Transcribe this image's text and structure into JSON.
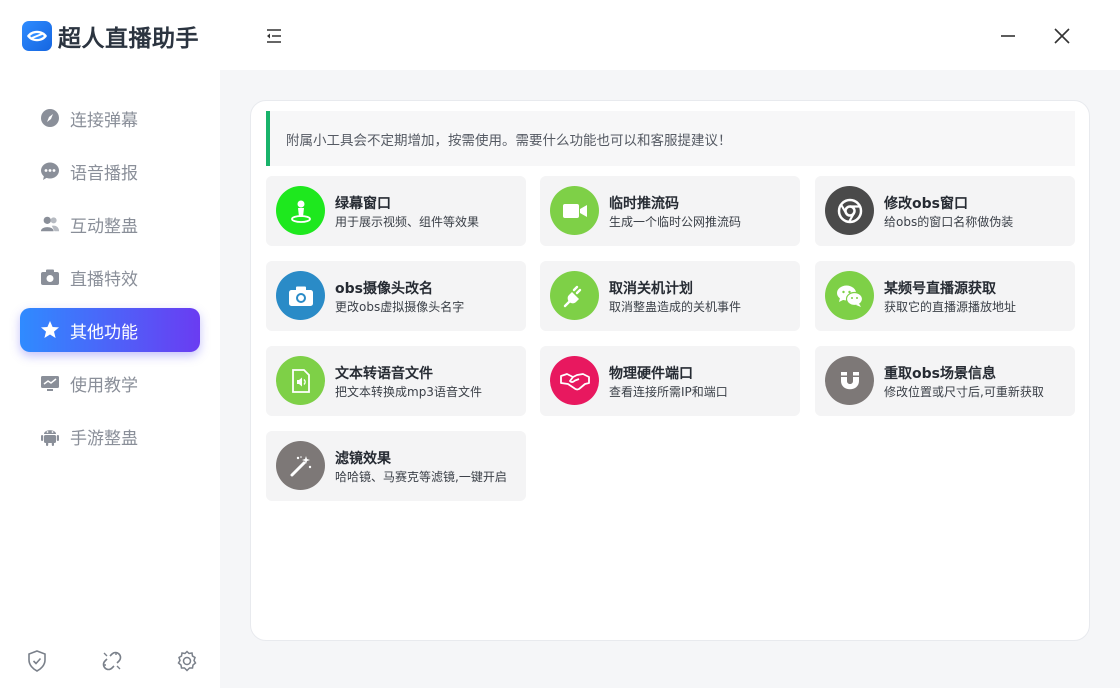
{
  "app": {
    "title": "超人直播助手"
  },
  "sidebar": {
    "items": [
      {
        "label": "连接弹幕",
        "icon": "compass-icon",
        "active": false
      },
      {
        "label": "语音播报",
        "icon": "chat-dots-icon",
        "active": false
      },
      {
        "label": "互动整蛊",
        "icon": "users-icon",
        "active": false
      },
      {
        "label": "直播特效",
        "icon": "camera-icon",
        "active": false
      },
      {
        "label": "其他功能",
        "icon": "star-icon",
        "active": true
      },
      {
        "label": "使用教学",
        "icon": "monitor-chart-icon",
        "active": false
      },
      {
        "label": "手游整蛊",
        "icon": "android-icon",
        "active": false
      }
    ],
    "bottom_icons": [
      "shield-check-icon",
      "broken-link-icon",
      "gear-icon"
    ]
  },
  "notice": {
    "text": "附属小工具会不定期增加，按需使用。需要什么功能也可以和客服提建议！"
  },
  "tools": [
    {
      "title": "绿幕窗口",
      "desc": "用于展示视频、组件等效果",
      "icon": "person-pin-icon",
      "color": "#1ee81e"
    },
    {
      "title": "临时推流码",
      "desc": "生成一个临时公网推流码",
      "icon": "video-camera-icon",
      "color": "#7ed047"
    },
    {
      "title": "修改obs窗口",
      "desc": "给obs的窗口名称做伪装",
      "icon": "chrome-icon",
      "color": "#4a4a4a"
    },
    {
      "title": "obs摄像头改名",
      "desc": "更改obs虚拟摄像头名字",
      "icon": "camera-icon",
      "color": "#2a8bc7"
    },
    {
      "title": "取消关机计划",
      "desc": "取消整蛊造成的关机事件",
      "icon": "plug-icon",
      "color": "#7ed047"
    },
    {
      "title": "某频号直播源获取",
      "desc": "获取它的直播源播放地址",
      "icon": "wechat-icon",
      "color": "#7ed047"
    },
    {
      "title": "文本转语音文件",
      "desc": "把文本转换成mp3语音文件",
      "icon": "audio-file-icon",
      "color": "#7ed047"
    },
    {
      "title": "物理硬件端口",
      "desc": "查看连接所需IP和端口",
      "icon": "handshake-icon",
      "color": "#e8185f"
    },
    {
      "title": "重取obs场景信息",
      "desc": "修改位置或尺寸后,可重新获取",
      "icon": "magnet-icon",
      "color": "#7d7877"
    },
    {
      "title": "滤镜效果",
      "desc": "哈哈镜、马赛克等滤镜,一键开启",
      "icon": "magic-wand-icon",
      "color": "#7d7877"
    }
  ],
  "colors": {
    "accent_start": "#2f8bff",
    "accent_end": "#6a3cf2",
    "notice_bar": "#19b36b"
  }
}
